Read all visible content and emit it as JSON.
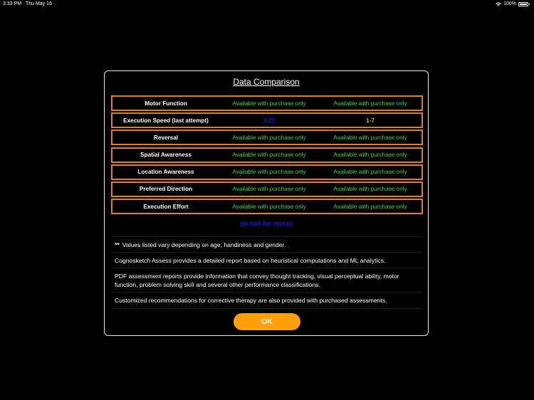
{
  "status_bar": {
    "time": "3:33 PM",
    "date": "Thu May 16",
    "battery": "100%"
  },
  "dialog": {
    "title": "Data Comparison",
    "rows": [
      {
        "label": "Motor Function",
        "col_a": "Available with purchase only",
        "col_b": "Available with purchase only"
      },
      {
        "label": "Execution Speed (last attempt)",
        "col_a": "3:23",
        "col_b": "1-7"
      },
      {
        "label": "Reversal",
        "col_a": "Available with purchase only",
        "col_b": "Available with purchase only"
      },
      {
        "label": "Spatial Awareness",
        "col_a": "Available with purchase only",
        "col_b": "Available with purchase only"
      },
      {
        "label": "Location Awareness",
        "col_a": "Available with purchase only",
        "col_b": "Available with purchase only"
      },
      {
        "label": "Preferred Direction",
        "col_a": "Available with purchase only",
        "col_b": "Available with purchase only"
      },
      {
        "label": "Execution Effort",
        "col_a": "Available with purchase only",
        "col_b": "Available with purchase only"
      }
    ],
    "scroll_hint": "(scroll for more)",
    "notes": {
      "stars": "**",
      "values_note": "Values listed vary depending on age, handiness and gender.",
      "report_note": "Cognosketch Assess provides a detailed report based on heuristical computations and ML analytics.",
      "pdf_note": "PDF assessment reports provide information that convey thought tracking, visual perceptual ability, motor function, problem solving skill and several other performance classifications.",
      "custom_note": "Customized recommendations for corrective therapy are also provided with purchased assessments."
    },
    "ok_label": "OK"
  },
  "colors": {
    "row_border": "#d9822b",
    "available_text": "#3fd13f",
    "value_blue": "#1a1ad6",
    "value_orange": "#ff9c1a",
    "ok_button": "#ff9f0a"
  }
}
